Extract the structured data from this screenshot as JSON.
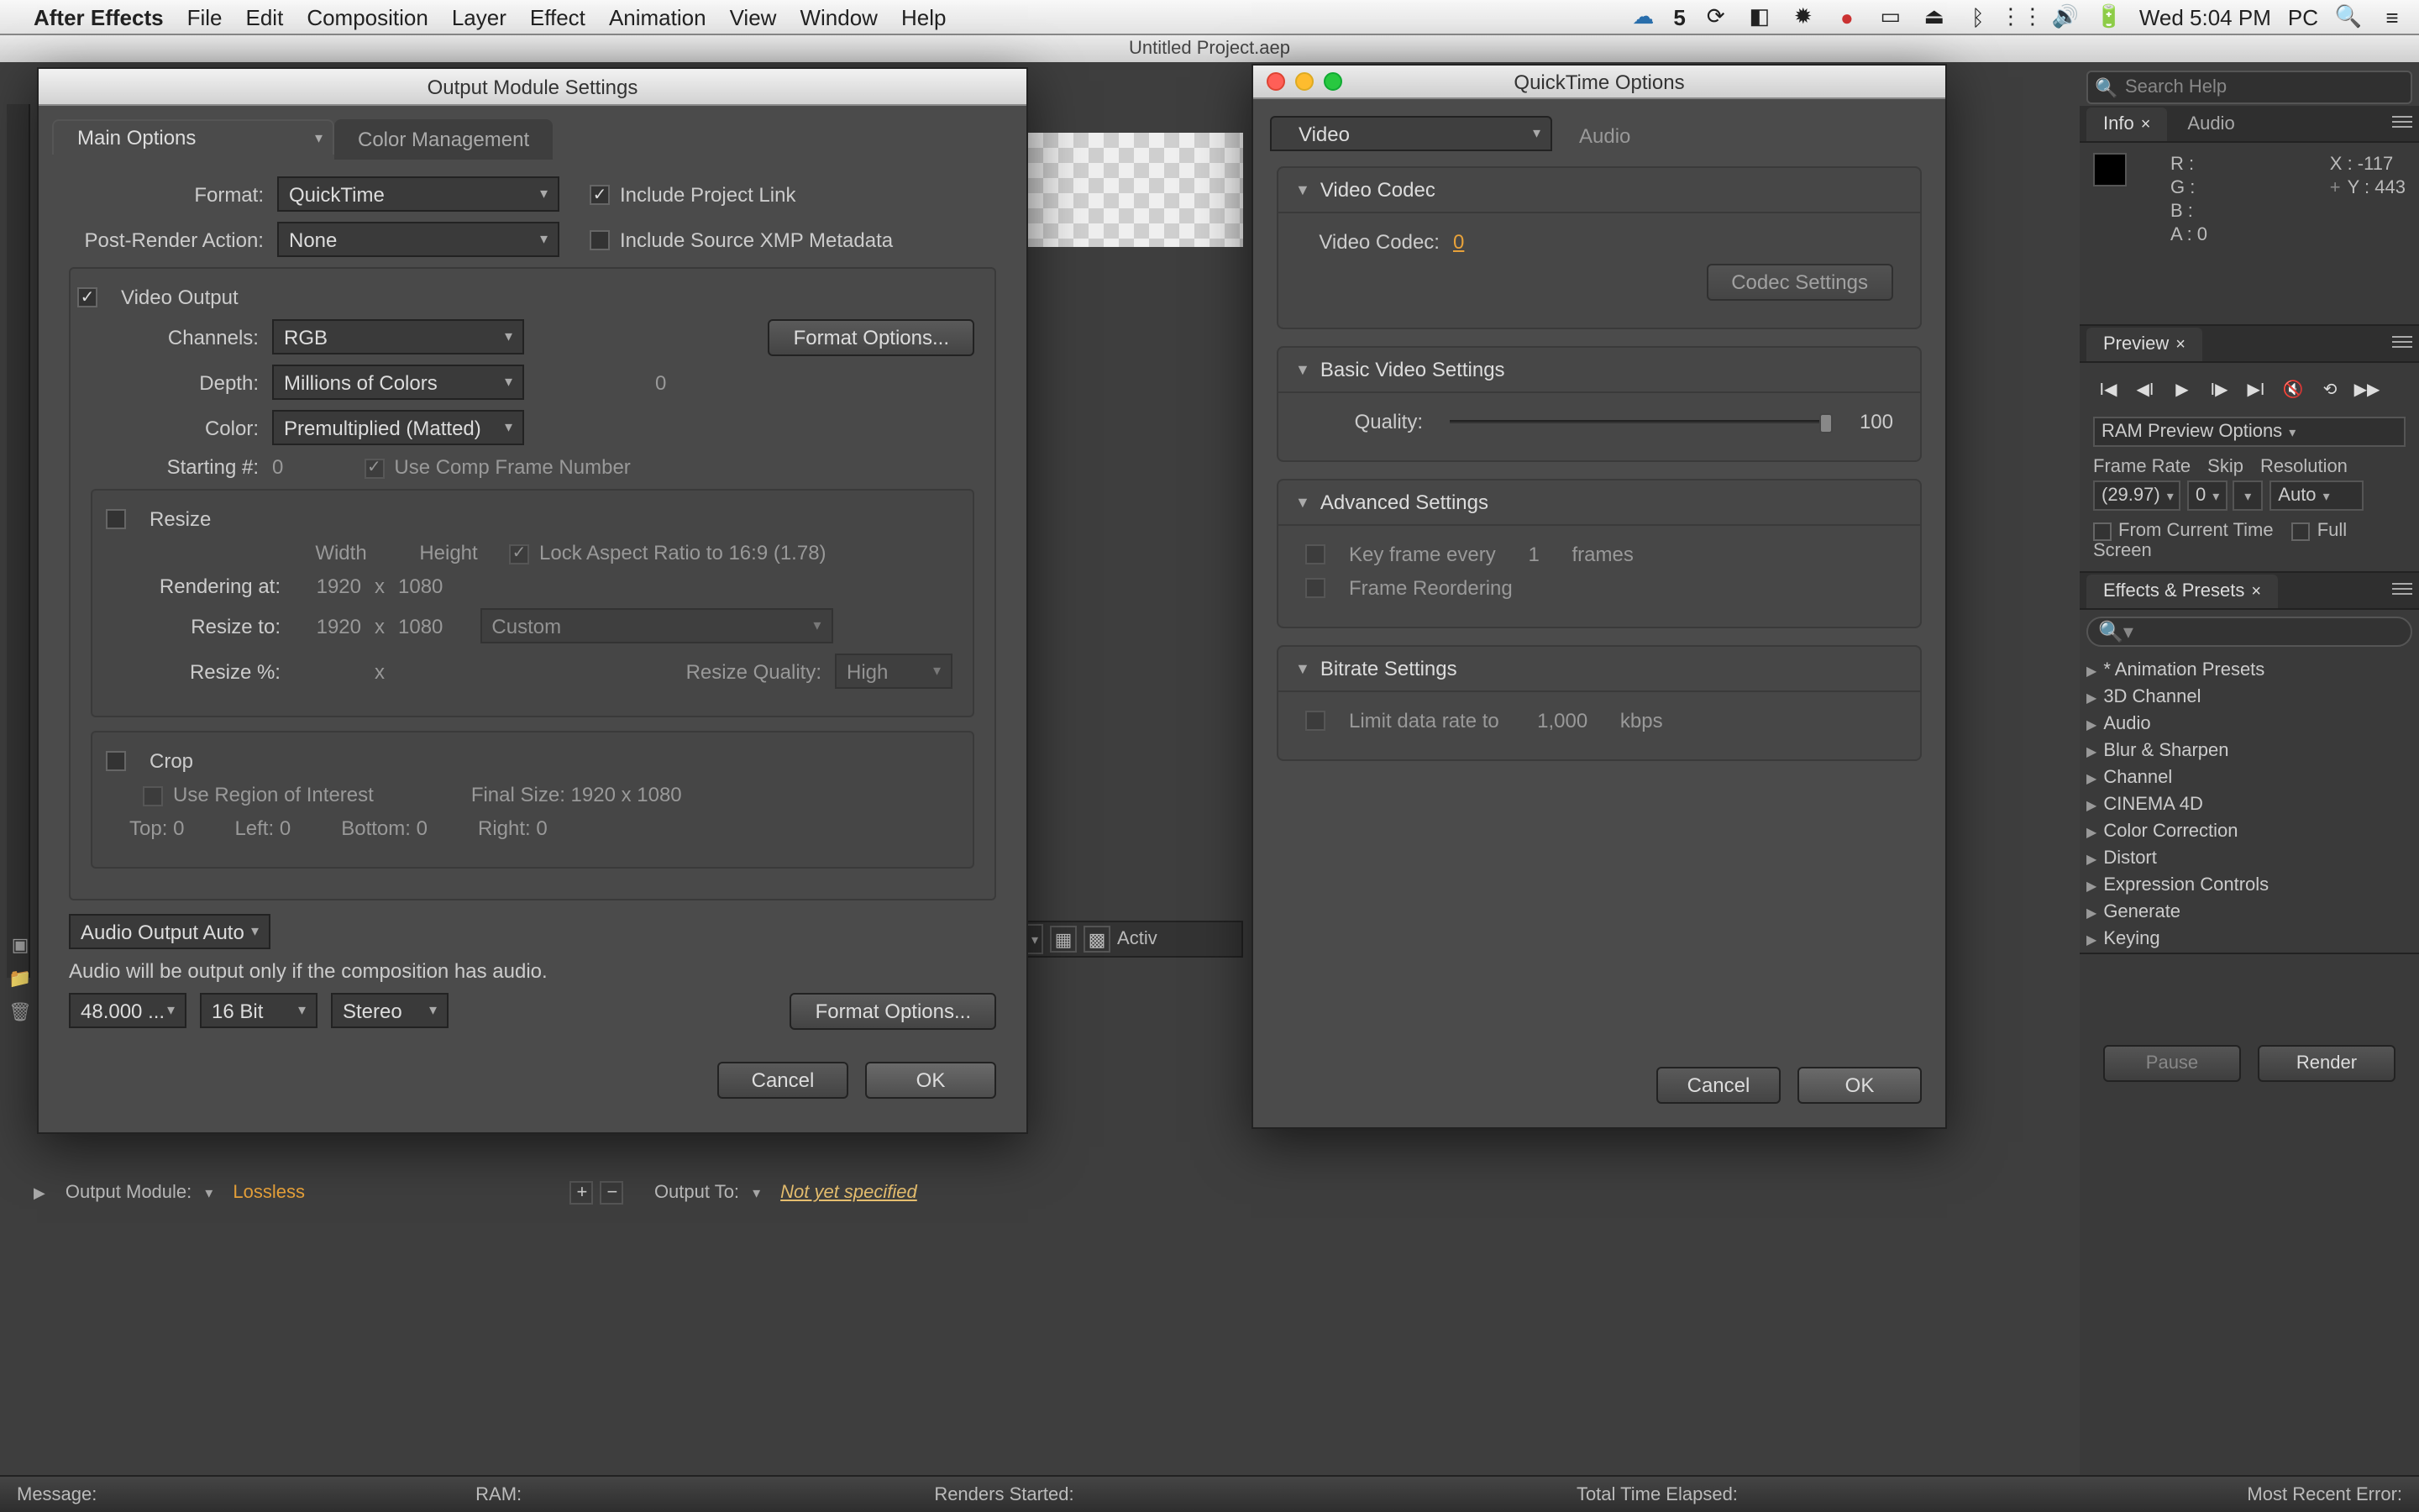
{
  "menubar": {
    "app": "After Effects",
    "items": [
      "File",
      "Edit",
      "Composition",
      "Layer",
      "Effect",
      "Animation",
      "View",
      "Window",
      "Help"
    ],
    "right": {
      "num5": "5",
      "clock": "Wed 5:04 PM",
      "user": "PC"
    }
  },
  "project_title": "Untitled Project.aep",
  "search_help": {
    "placeholder": "Search Help"
  },
  "info_panel": {
    "tabs": [
      "Info",
      "Audio"
    ],
    "R": "R :",
    "G": "G :",
    "B": "B :",
    "A": "A : 0",
    "X": "X : -117",
    "Y": "Y : 443",
    "plus": "+"
  },
  "preview_panel": {
    "tab": "Preview",
    "ram_label": "RAM Preview Options",
    "framerate_label": "Frame Rate",
    "skip_label": "Skip",
    "resolution_label": "Resolution",
    "framerate": "(29.97)",
    "skip": "0",
    "resolution": "Auto",
    "from_current": "From Current Time",
    "full_screen": "Full Screen"
  },
  "effects_panel": {
    "tab": "Effects & Presets",
    "items": [
      "* Animation Presets",
      "3D Channel",
      "Audio",
      "Blur & Sharpen",
      "Channel",
      "CINEMA 4D",
      "Color Correction",
      "Distort",
      "Expression Controls",
      "Generate",
      "Keying"
    ]
  },
  "oms": {
    "title": "Output Module Settings",
    "tabs": [
      "Main Options",
      "Color Management"
    ],
    "format_label": "Format:",
    "format": "QuickTime",
    "include_proj": "Include Project Link",
    "pra_label": "Post-Render Action:",
    "pra": "None",
    "include_xmp": "Include Source XMP Metadata",
    "video_output": "Video Output",
    "channels_label": "Channels:",
    "channels": "RGB",
    "format_options": "Format Options...",
    "depth_label": "Depth:",
    "depth": "Millions of Colors",
    "depth_val": "0",
    "color_label": "Color:",
    "color": "Premultiplied (Matted)",
    "starting_label": "Starting #:",
    "starting": "0",
    "use_comp": "Use Comp Frame Number",
    "resize": "Resize",
    "width": "Width",
    "height": "Height",
    "lock": "Lock Aspect Ratio to 16:9 (1.78)",
    "render_at": "Rendering at:",
    "r_w": "1920",
    "x": "x",
    "r_h": "1080",
    "resize_to": "Resize to:",
    "rs_w": "1920",
    "rs_h": "1080",
    "custom": "Custom",
    "resize_pct": "Resize %:",
    "resize_quality": "Resize Quality:",
    "quality": "High",
    "crop": "Crop",
    "roi": "Use Region of Interest",
    "final_size": "Final Size: 1920 x 1080",
    "top": "Top:",
    "tval": "0",
    "left": "Left:",
    "lval": "0",
    "bottom": "Bottom:",
    "bval": "0",
    "right": "Right:",
    "rval": "0",
    "audio_out": "Audio Output Auto",
    "audio_note": "Audio will be output only if the composition has audio.",
    "khz": "48.000 ...",
    "bits": "16 Bit",
    "stereo": "Stereo",
    "cancel": "Cancel",
    "ok": "OK"
  },
  "qt": {
    "title": "QuickTime Options",
    "tabs": [
      "Video",
      "Audio"
    ],
    "s_video_codec": "Video Codec",
    "codec_label": "Video Codec:",
    "codec_val": "0",
    "codec_settings": "Codec Settings",
    "s_basic": "Basic Video Settings",
    "quality_label": "Quality:",
    "quality_val": "100",
    "s_adv": "Advanced Settings",
    "keyframe": "Key frame every",
    "keyframe_unit": "frames",
    "keyframe_val": "1",
    "reorder": "Frame Reordering",
    "s_bitrate": "Bitrate Settings",
    "limit": "Limit data rate to",
    "limit_val": "1,000",
    "limit_unit": "kbps",
    "cancel": "Cancel",
    "ok": "OK"
  },
  "rq": {
    "out_module": "Output Module:",
    "lossless": "Lossless",
    "out_to": "Output To:",
    "not_yet": "Not yet specified"
  },
  "viewerbar": {
    "active": "Activ"
  },
  "render": {
    "pause": "Pause",
    "render": "Render"
  },
  "status": {
    "msg": "Message:",
    "ram": "RAM:",
    "renders": "Renders Started:",
    "elapsed": "Total Time Elapsed:",
    "err": "Most Recent Error:"
  }
}
